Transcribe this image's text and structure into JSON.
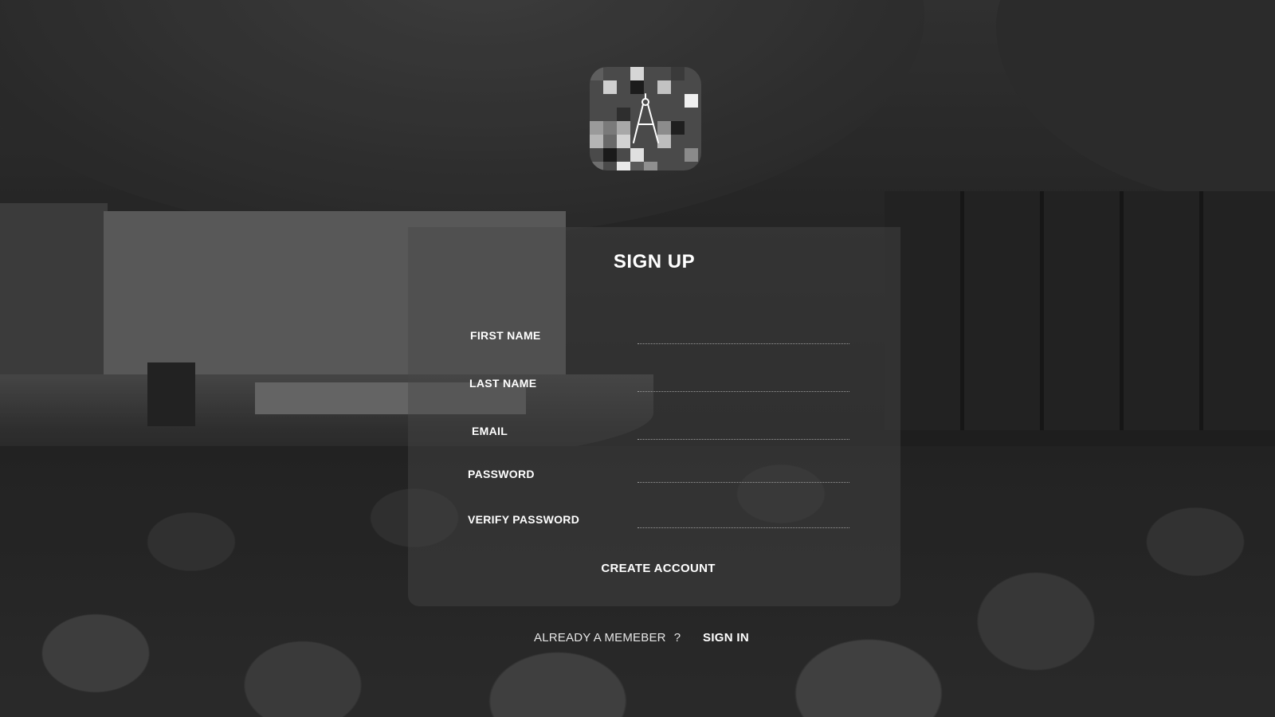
{
  "form": {
    "title": "SIGN UP",
    "fields": [
      {
        "label": "FIRST NAME",
        "value": ""
      },
      {
        "label": "LAST NAME",
        "value": ""
      },
      {
        "label": "EMAIL",
        "value": ""
      },
      {
        "label": "PASSWORD",
        "value": ""
      },
      {
        "label": "VERIFY PASSWORD",
        "value": ""
      }
    ],
    "submit_label": "CREATE ACCOUNT"
  },
  "footer": {
    "question": "ALREADY A MEMEBER",
    "question_mark": "?",
    "signin_label": "SIGN IN"
  },
  "logo": {
    "icon": "drafting-compass-icon"
  },
  "colors": {
    "text": "#ffffff",
    "panel": "#464646",
    "underline": "#9a9a9a"
  }
}
